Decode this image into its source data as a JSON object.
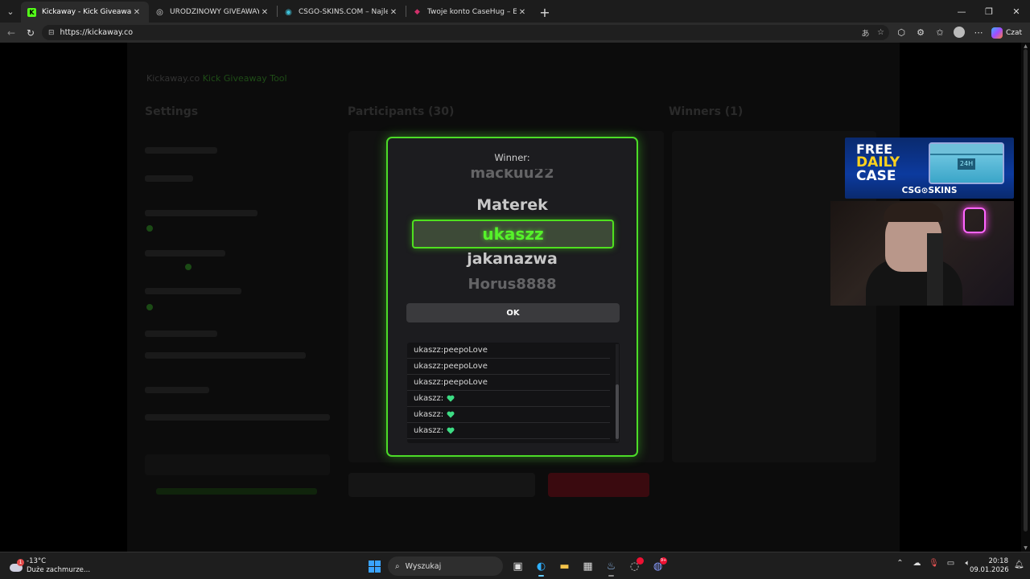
{
  "browser": {
    "tabs": [
      {
        "title": "Kickaway - Kick Giveaway Tool",
        "favicon_color": "#53fc18",
        "favicon_glyph": "K",
        "active": true
      },
      {
        "title": "URODZINOWY GIVEAWAY KAMILKA",
        "favicon_color": "#dddddd",
        "favicon_glyph": "◎",
        "active": false
      },
      {
        "title": "CSGO-SKINS.COM – Najlepsze Skrzynki",
        "favicon_color": "#3ec0d8",
        "favicon_glyph": "◉",
        "active": false
      },
      {
        "title": "Twoje konto CaseHug – Ekwipunek",
        "favicon_color": "#d0306a",
        "favicon_glyph": "◆",
        "active": false
      }
    ],
    "url": "https://kickaway.co",
    "copilot_label": "Czat"
  },
  "background_app": {
    "brand_prefix": "Kickaway.co",
    "brand_suffix": "Kick Giveaway Tool",
    "settings_heading": "Settings",
    "participants_heading": "Participants (30)",
    "winners_heading": "Winners (1)"
  },
  "modal": {
    "winner_label": "Winner:",
    "reel_names": [
      "mackuu22",
      "Materek",
      "ukaszz",
      "jakanazwa",
      "Horus8888"
    ],
    "winner_name": "ukaszz",
    "ok_label": "OK",
    "chat_messages": [
      {
        "user": "ukaszz",
        "text": "peepoLove",
        "emote": ""
      },
      {
        "user": "ukaszz",
        "text": "peepoLove",
        "emote": ""
      },
      {
        "user": "ukaszz",
        "text": "peepoLove",
        "emote": ""
      },
      {
        "user": "ukaszz",
        "text": "",
        "emote": "green-heart"
      },
      {
        "user": "ukaszz",
        "text": "",
        "emote": "green-heart"
      },
      {
        "user": "ukaszz",
        "text": "",
        "emote": "green-heart"
      }
    ],
    "accent_color": "#4cdc28"
  },
  "overlay_ad": {
    "line1": "FREE",
    "line2": "DAILY",
    "line3": "CASE",
    "case_tag": "24H",
    "brand": "CSG⊙SKINS"
  },
  "taskbar": {
    "weather_temp": "-13°C",
    "weather_desc": "Duże zachmurze...",
    "weather_badge": "1",
    "search_placeholder": "Wyszukaj",
    "time": "20:18",
    "date": "09.01.2026",
    "discord_badge": "9+"
  }
}
